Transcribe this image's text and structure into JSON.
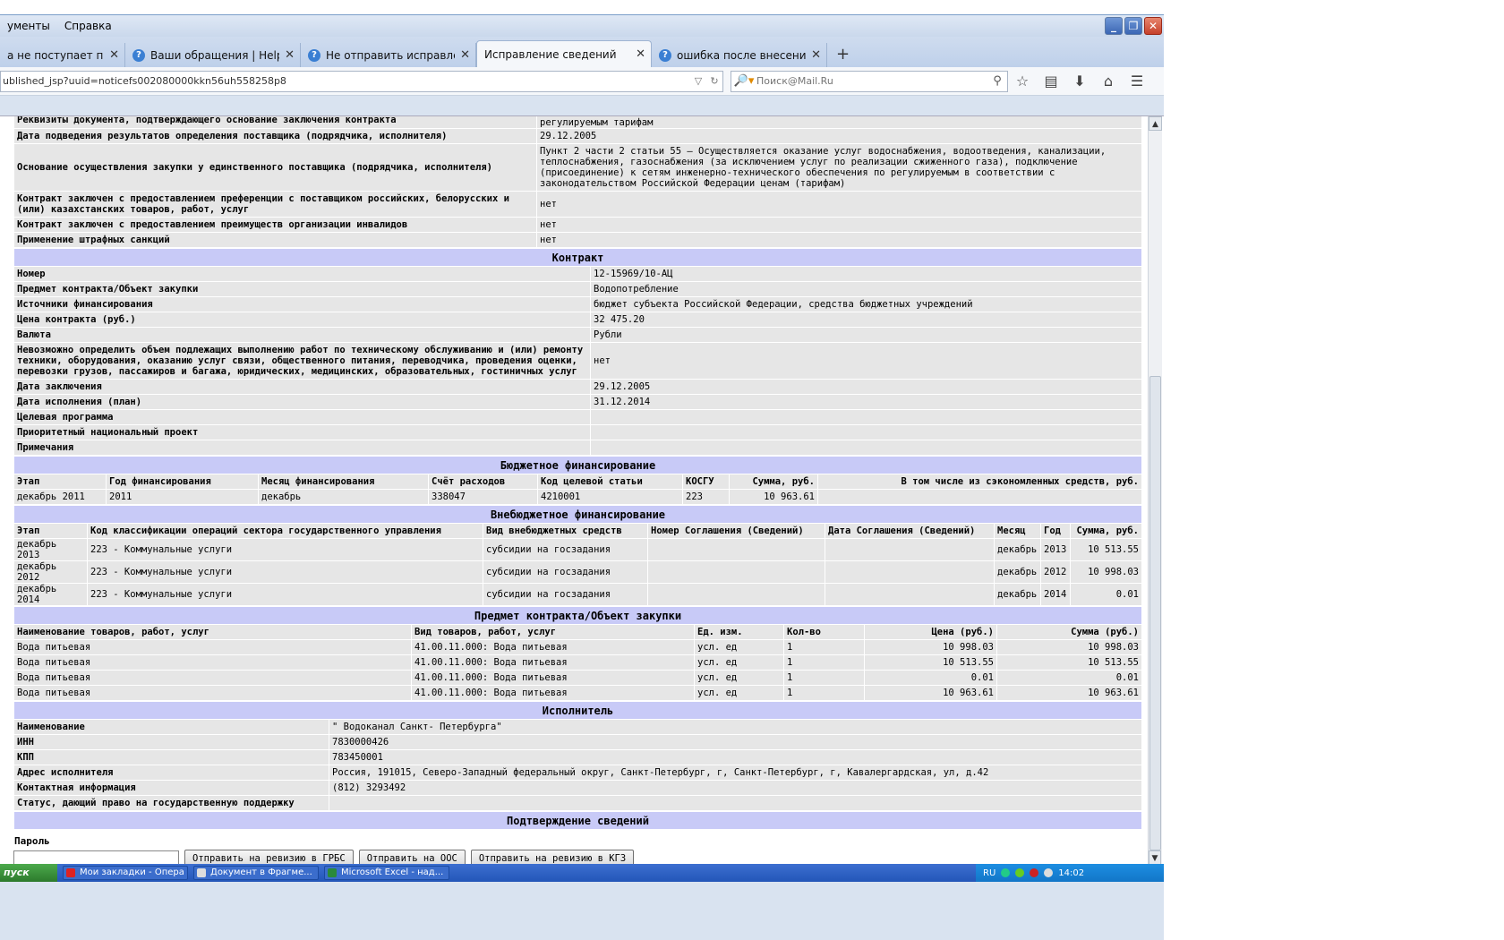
{
  "browser": {
    "menus": [
      "ументы",
      "Справка"
    ],
    "window_controls": {
      "minimize": "_",
      "restore": "❐",
      "close": "✕"
    },
    "tabs": [
      {
        "label": "а не поступает подт...",
        "icon": false,
        "active": false
      },
      {
        "label": "Ваши обращения | HelpDesk ...",
        "icon": true,
        "active": false
      },
      {
        "label": "Не отправить исправление ...",
        "icon": true,
        "active": false
      },
      {
        "label": "Исправление сведений",
        "icon": false,
        "active": true
      },
      {
        "label": "ошибка после внесения изм...",
        "icon": true,
        "active": false
      }
    ],
    "new_tab": "+",
    "close_glyph": "✕",
    "url": "ublished_jsp?uuid=noticefs002080000kkn56uh558258p8",
    "search_placeholder": "Поиск@Mail.Ru"
  },
  "sections": {
    "top": {
      "rows": [
        {
          "label": "Реквизиты документа, подтверждающего основание заключения контракта",
          "value": "регулируемым тарифам"
        },
        {
          "label": "Дата подведения результатов определения поставщика (подрядчика, исполнителя)",
          "value": "29.12.2005"
        },
        {
          "label": "Основание осуществления закупки у единственного поставщика (подрядчика, исполнителя)",
          "value": "Пункт 2 части 2 статьи 55 – Осуществляется оказание услуг водоснабжения, водоотведения, канализации, теплоснабжения, газоснабжения (за исключением услуг по реализации сжиженного газа), подключение (присоединение) к сетям инженерно-технического обеспечения по регулируемым в соответствии с законодательством Российской Федерации ценам (тарифам)"
        },
        {
          "label": "Контракт заключен с предоставлением преференции с поставщиком российских, белорусских и (или) казахстанских товаров, работ, услуг",
          "value": "нет"
        },
        {
          "label": "Контракт заключен с предоставлением преимуществ организации инвалидов",
          "value": "нет"
        },
        {
          "label": "Применение штрафных санкций",
          "value": "нет"
        }
      ]
    },
    "contract": {
      "title": "Контракт",
      "rows": [
        {
          "label": "Номер",
          "value": "12-15969/10-АЦ"
        },
        {
          "label": "Предмет контракта/Объект закупки",
          "value": "Водопотребление"
        },
        {
          "label": "Источники финансирования",
          "value": "бюджет субъекта Российской Федерации, средства бюджетных учреждений"
        },
        {
          "label": "Цена контракта (руб.)",
          "value": "32 475.20"
        },
        {
          "label": "Валюта",
          "value": "Рубли"
        },
        {
          "label": "Невозможно определить объем подлежащих выполнению работ по техническому обслуживанию и (или) ремонту техники, оборудования, оказанию услуг связи, общественного питания, переводчика, проведения оценки, перевозки грузов, пассажиров и багажа, юридических, медицинских, образовательных, гостиничных услуг",
          "value": "нет"
        },
        {
          "label": "Дата заключения",
          "value": "29.12.2005"
        },
        {
          "label": "Дата исполнения (план)",
          "value": "31.12.2014"
        },
        {
          "label": "Целевая программа",
          "value": ""
        },
        {
          "label": "Приоритетный национальный проект",
          "value": ""
        },
        {
          "label": "Примечания",
          "value": ""
        }
      ]
    },
    "budget": {
      "title": "Бюджетное финансирование",
      "headers": [
        "Этап",
        "Год финансирования",
        "Месяц финансирования",
        "Счёт расходов",
        "Код целевой статьи",
        "КОСГУ",
        "Сумма, руб.",
        "В том числе из сэкономленных средств, руб."
      ],
      "rows": [
        [
          "декабрь 2011",
          "2011",
          "декабрь",
          "338047",
          "4210001",
          "223",
          "10 963.61",
          ""
        ]
      ]
    },
    "extrabudget": {
      "title": "Внебюджетное финансирование",
      "headers": [
        "Этап",
        "Код классификации операций сектора государственного управления",
        "Вид внебюджетных средств",
        "Номер Соглашения (Сведений)",
        "Дата Соглашения (Сведений)",
        "Месяц",
        "Год",
        "Сумма, руб."
      ],
      "rows": [
        [
          "декабрь 2013",
          "223 - Коммунальные услуги",
          "субсидии на госзадания",
          "",
          "",
          "декабрь",
          "2013",
          "10 513.55"
        ],
        [
          "декабрь 2012",
          "223 - Коммунальные услуги",
          "субсидии на госзадания",
          "",
          "",
          "декабрь",
          "2012",
          "10 998.03"
        ],
        [
          "декабрь 2014",
          "223 - Коммунальные услуги",
          "субсидии на госзадания",
          "",
          "",
          "декабрь",
          "2014",
          "0.01"
        ]
      ]
    },
    "subject": {
      "title": "Предмет контракта/Объект закупки",
      "headers": [
        "Наименование товаров, работ, услуг",
        "Вид товаров, работ, услуг",
        "Ед. изм.",
        "Кол-во",
        "Цена (руб.)",
        "Сумма (руб.)"
      ],
      "rows": [
        [
          "Вода питьевая",
          "41.00.11.000: Вода питьевая",
          "усл. ед",
          "1",
          "10 998.03",
          "10 998.03"
        ],
        [
          "Вода питьевая",
          "41.00.11.000: Вода питьевая",
          "усл. ед",
          "1",
          "10 513.55",
          "10 513.55"
        ],
        [
          "Вода питьевая",
          "41.00.11.000: Вода питьевая",
          "усл. ед",
          "1",
          "0.01",
          "0.01"
        ],
        [
          "Вода питьевая",
          "41.00.11.000: Вода питьевая",
          "усл. ед",
          "1",
          "10 963.61",
          "10 963.61"
        ]
      ]
    },
    "executor": {
      "title": "Исполнитель",
      "rows": [
        {
          "label": "Наименование",
          "value": "\" Водоканал Санкт- Петербурга\""
        },
        {
          "label": "ИНН",
          "value": "7830000426"
        },
        {
          "label": "КПП",
          "value": "783450001"
        },
        {
          "label": "Адрес исполнителя",
          "value": "Россия, 191015, Северо-Западный федеральный округ, Санкт-Петербург, г, Санкт-Петербург, г, Кавалергардская, ул, д.42"
        },
        {
          "label": "Контактная информация",
          "value": "(812) 3293492"
        },
        {
          "label": "Статус, дающий право на государственную поддержку",
          "value": ""
        }
      ]
    },
    "confirm": {
      "title": "Подтверждение сведений",
      "password_label": "Пароль",
      "buttons": [
        "Отправить на ревизию в ГРБС",
        "Отправить на ООС",
        "Отправить на ревизию в КГЗ"
      ]
    }
  },
  "taskbar": {
    "start": "пуск",
    "items": [
      "Мои закладки - Опера",
      "Документ в Фрагме...",
      "Microsoft Excel - над..."
    ],
    "lang": "RU",
    "clock": "14:02"
  }
}
